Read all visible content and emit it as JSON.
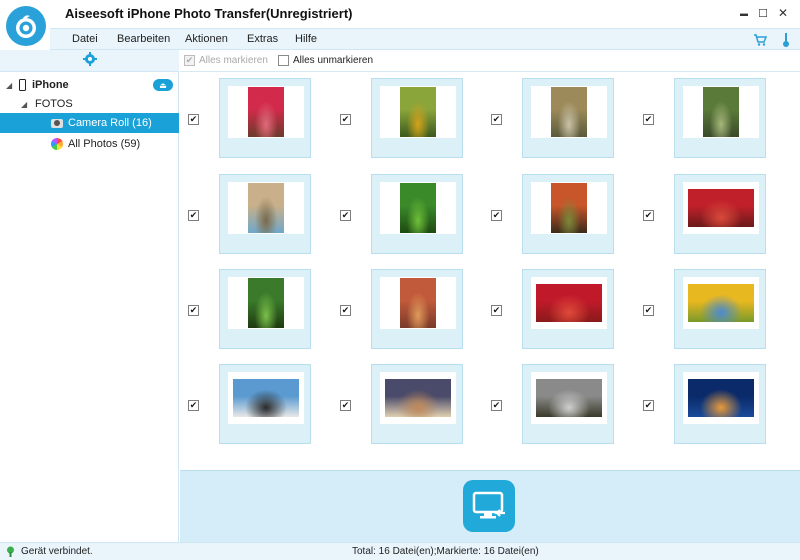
{
  "app": {
    "title": "Aiseesoft iPhone Photo Transfer(Unregistriert)"
  },
  "window_controls": {
    "minimize": "▬",
    "maximize": "☐",
    "close": "✕"
  },
  "menu": [
    {
      "label": "Datei"
    },
    {
      "label": "Bearbeiten"
    },
    {
      "label": "Aktionen"
    },
    {
      "label": "Extras"
    },
    {
      "label": "Hilfe"
    }
  ],
  "menu_right_icons": [
    "cart-icon",
    "thermometer-icon"
  ],
  "sidebar": {
    "settings_icon": "gear-icon",
    "device": {
      "label": "iPhone",
      "eject_icon": "eject-icon"
    },
    "group": {
      "label": "FOTOS"
    },
    "items": [
      {
        "label": "Camera Roll (16)",
        "icon": "camera-icon",
        "selected": true
      },
      {
        "label": "All Photos (59)",
        "icon": "photos-icon",
        "selected": false
      }
    ]
  },
  "toolbar": {
    "select_all": {
      "label": "Alles markieren",
      "checked": true,
      "disabled": true
    },
    "unselect_all": {
      "label": "Alles unmarkieren",
      "checked": false,
      "disabled": false
    }
  },
  "photos": [
    {
      "checked": true,
      "colors": [
        "#d12a4b",
        "#e06a7a",
        "#6b3b2a"
      ],
      "orientation": "portrait"
    },
    {
      "checked": true,
      "colors": [
        "#8aa53a",
        "#d5a21a",
        "#3b5a1e"
      ],
      "orientation": "portrait"
    },
    {
      "checked": true,
      "colors": [
        "#9c8a5a",
        "#c9c2a8",
        "#5a5a3a"
      ],
      "orientation": "portrait"
    },
    {
      "checked": true,
      "colors": [
        "#5a7a3a",
        "#a6b77a",
        "#3a4a2a"
      ],
      "orientation": "portrait"
    },
    {
      "checked": true,
      "colors": [
        "#c9b08a",
        "#7a6a4a",
        "#6fa7c9"
      ],
      "orientation": "portrait"
    },
    {
      "checked": true,
      "colors": [
        "#3a8a2a",
        "#6fbf3a",
        "#1e4a12"
      ],
      "orientation": "portrait"
    },
    {
      "checked": true,
      "colors": [
        "#c8562a",
        "#7a8a3a",
        "#3a2a1a"
      ],
      "orientation": "portrait"
    },
    {
      "checked": true,
      "colors": [
        "#c0202a",
        "#d84a3a",
        "#6a1a1a"
      ],
      "orientation": "landscape"
    },
    {
      "checked": true,
      "colors": [
        "#3a7a2a",
        "#7ac04a",
        "#1e3a10"
      ],
      "orientation": "portrait"
    },
    {
      "checked": true,
      "colors": [
        "#c05a3a",
        "#e09a5a",
        "#7a3a2a"
      ],
      "orientation": "portrait"
    },
    {
      "checked": true,
      "colors": [
        "#c01a2a",
        "#e04a3a",
        "#8a1a1a"
      ],
      "orientation": "landscape"
    },
    {
      "checked": true,
      "colors": [
        "#e8b820",
        "#4a8ad0",
        "#7a9a2a"
      ],
      "orientation": "landscape"
    },
    {
      "checked": true,
      "colors": [
        "#5a9ad0",
        "#2a2a2a",
        "#e8e8e8"
      ],
      "orientation": "landscape"
    },
    {
      "checked": true,
      "colors": [
        "#4a4a6a",
        "#c08a5a",
        "#e0d0b0"
      ],
      "orientation": "landscape"
    },
    {
      "checked": true,
      "colors": [
        "#8a8a8a",
        "#d0d0d0",
        "#3a3a2a"
      ],
      "orientation": "landscape"
    },
    {
      "checked": true,
      "colors": [
        "#0a2a6a",
        "#e89a3a",
        "#1a4a9a"
      ],
      "orientation": "landscape"
    }
  ],
  "export": {
    "icon": "export-to-pc-icon"
  },
  "status": {
    "connection": "Gerät verbindet.",
    "summary": "Total: 16 Datei(en);Markierte: 16 Datei(en)"
  },
  "colors": {
    "accent": "#1aa2d8",
    "panel": "#e9f4fb",
    "thumb_bg": "#dcf0f8"
  }
}
